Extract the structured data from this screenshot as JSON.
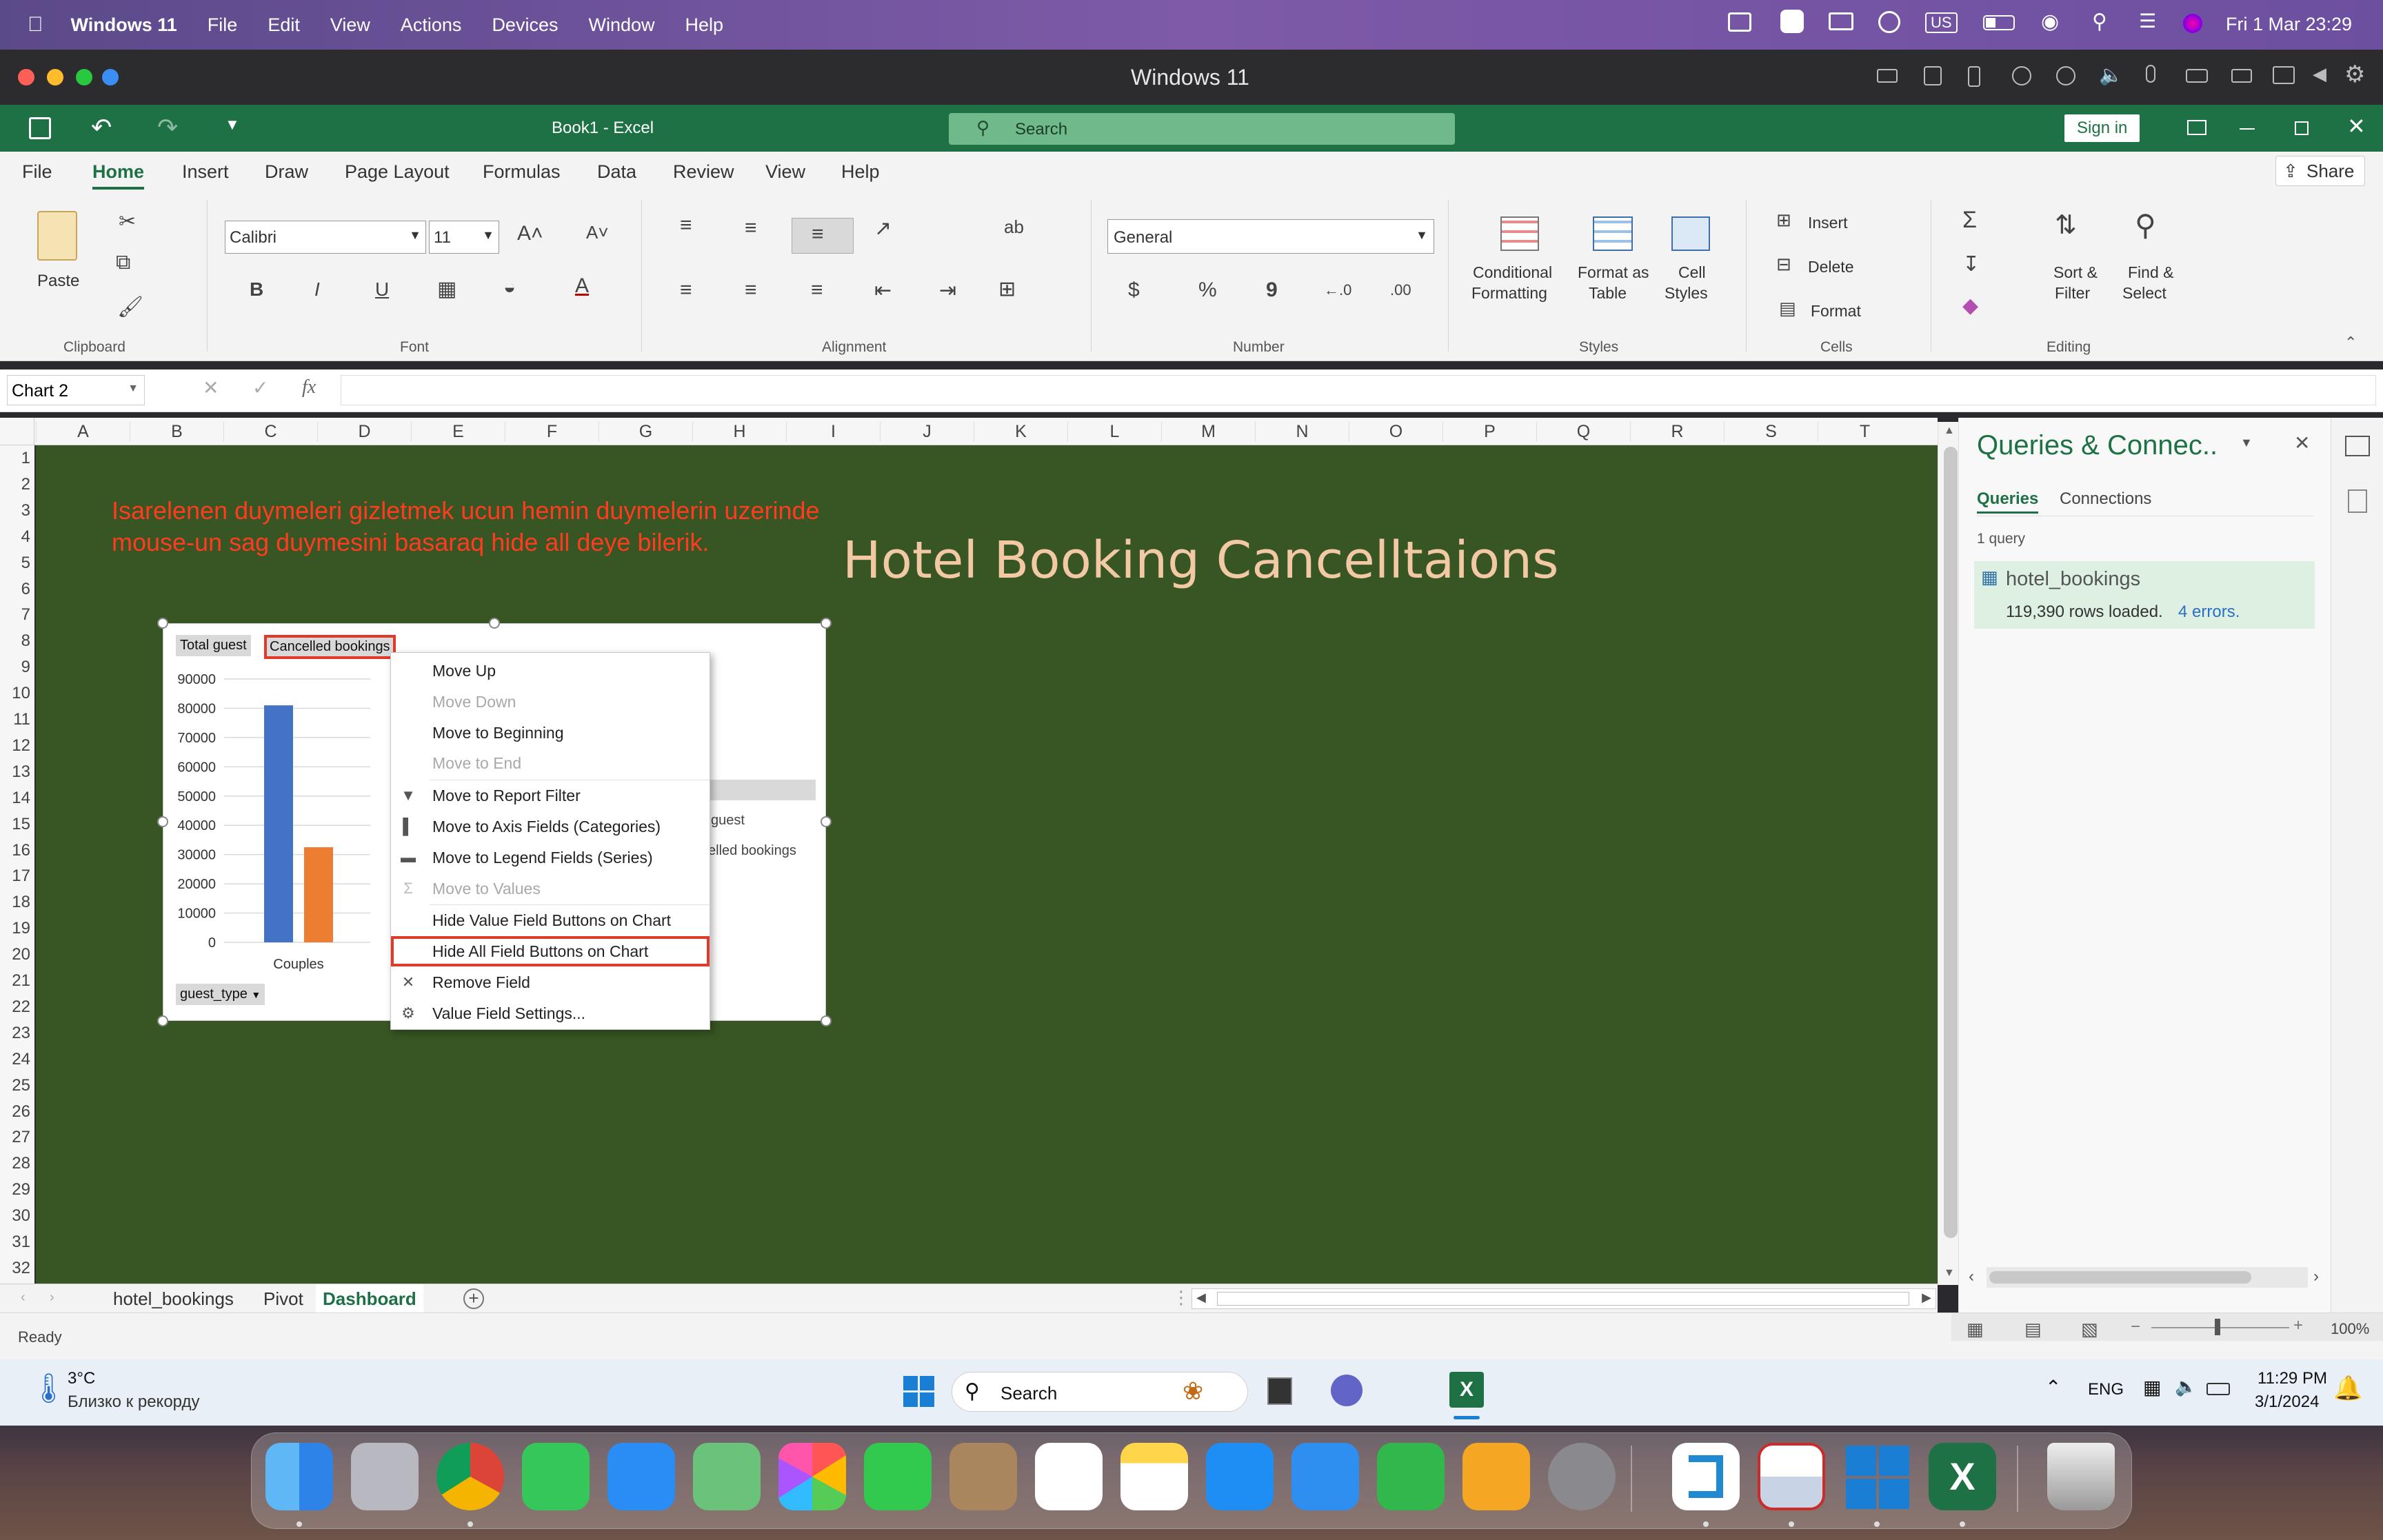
{
  "mac_menubar": {
    "app": "Windows 11",
    "menus": [
      "File",
      "Edit",
      "View",
      "Actions",
      "Devices",
      "Window",
      "Help"
    ],
    "input_source": "US",
    "datetime": "Fri 1 Mar  23:29"
  },
  "vm_window": {
    "title": "Windows 11"
  },
  "excel": {
    "doc_title": "Book1  -  Excel",
    "search_placeholder": "Search",
    "sign_in": "Sign in",
    "share": "Share",
    "tabs": [
      "File",
      "Home",
      "Insert",
      "Draw",
      "Page Layout",
      "Formulas",
      "Data",
      "Review",
      "View",
      "Help"
    ],
    "active_tab": "Home",
    "ribbon": {
      "paste": "Paste",
      "font_name": "Calibri",
      "font_size": "11",
      "number_format": "General",
      "conditional_formatting": [
        "Conditional",
        "Formatting"
      ],
      "format_as_table": [
        "Format as",
        "Table"
      ],
      "cell_styles": [
        "Cell",
        "Styles"
      ],
      "insert": "Insert",
      "delete": "Delete",
      "format": "Format",
      "sort_filter": [
        "Sort &",
        "Filter"
      ],
      "find_select": [
        "Find &",
        "Select"
      ],
      "groups": {
        "clipboard": "Clipboard",
        "font": "Font",
        "alignment": "Alignment",
        "number": "Number",
        "styles": "Styles",
        "cells": "Cells",
        "editing": "Editing"
      }
    },
    "name_box": "Chart 2",
    "fx": "fx",
    "columns": [
      "A",
      "B",
      "C",
      "D",
      "E",
      "F",
      "G",
      "H",
      "I",
      "J",
      "K",
      "L",
      "M",
      "N",
      "O",
      "P",
      "Q",
      "R",
      "S",
      "T"
    ],
    "rows": [
      "1",
      "2",
      "3",
      "4",
      "5",
      "6",
      "7",
      "8",
      "9",
      "10",
      "11",
      "12",
      "13",
      "14",
      "15",
      "16",
      "17",
      "18",
      "19",
      "20",
      "21",
      "22",
      "23",
      "24",
      "25",
      "26",
      "27",
      "28",
      "29",
      "30",
      "31",
      "32"
    ],
    "annotation_lines": [
      "Isarelenen duymeleri gizletmek ucun hemin duymelerin uzerinde",
      "mouse-un sag duymesini basaraq hide all deye bilerik."
    ],
    "dashboard_title": "Hotel Booking Cancelltaions",
    "sheet_tabs": [
      "hotel_bookings",
      "Pivot",
      "Dashboard"
    ],
    "active_sheet": "Dashboard",
    "status": "Ready",
    "zoom": "100%"
  },
  "chart_data": {
    "type": "bar",
    "field_buttons": [
      "Total guest",
      "Cancelled bookings"
    ],
    "axis_field_button": "guest_type",
    "categories": [
      "Couples"
    ],
    "series": [
      {
        "name": "Total guest",
        "values": [
          81000
        ],
        "color": "#4472c4"
      },
      {
        "name": "Cancelled bookings",
        "values": [
          32500
        ],
        "color": "#ed7d31"
      }
    ],
    "ylim": [
      0,
      90000
    ],
    "yticks": [
      "0",
      "10000",
      "20000",
      "30000",
      "40000",
      "50000",
      "60000",
      "70000",
      "80000",
      "90000"
    ],
    "legend_partial": [
      "guest",
      "elled bookings"
    ]
  },
  "context_menu": {
    "items": [
      {
        "label": "Move Up",
        "disabled": false,
        "icon": ""
      },
      {
        "label": "Move Down",
        "disabled": true,
        "icon": ""
      },
      {
        "label": "Move to Beginning",
        "disabled": false,
        "icon": ""
      },
      {
        "label": "Move to End",
        "disabled": true,
        "icon": ""
      },
      {
        "label": "Move to Report Filter",
        "disabled": false,
        "icon": "filter-icon"
      },
      {
        "label": "Move to Axis Fields (Categories)",
        "disabled": false,
        "icon": "axis-fields-icon"
      },
      {
        "label": "Move to Legend Fields (Series)",
        "disabled": false,
        "icon": "legend-fields-icon"
      },
      {
        "label": "Move to Values",
        "disabled": true,
        "icon": "sigma-icon"
      },
      {
        "label": "Hide Value Field Buttons on Chart",
        "disabled": false,
        "icon": ""
      },
      {
        "label": "Hide All Field Buttons on Chart",
        "disabled": false,
        "icon": "",
        "highlighted": true
      },
      {
        "label": "Remove Field",
        "disabled": false,
        "icon": "remove-icon"
      },
      {
        "label": "Value Field Settings...",
        "disabled": false,
        "icon": "settings-icon"
      }
    ]
  },
  "queries_panel": {
    "title": "Queries & Connec..",
    "tabs": [
      "Queries",
      "Connections"
    ],
    "count": "1 query",
    "query_name": "hotel_bookings",
    "rows_loaded": "119,390 rows loaded.",
    "errors": "4 errors."
  },
  "windows_taskbar": {
    "temp": "3°C",
    "weather": "Близко к рекорду",
    "search": "Search",
    "lang": "ENG",
    "time": "11:29 PM",
    "date": "3/1/2024"
  }
}
